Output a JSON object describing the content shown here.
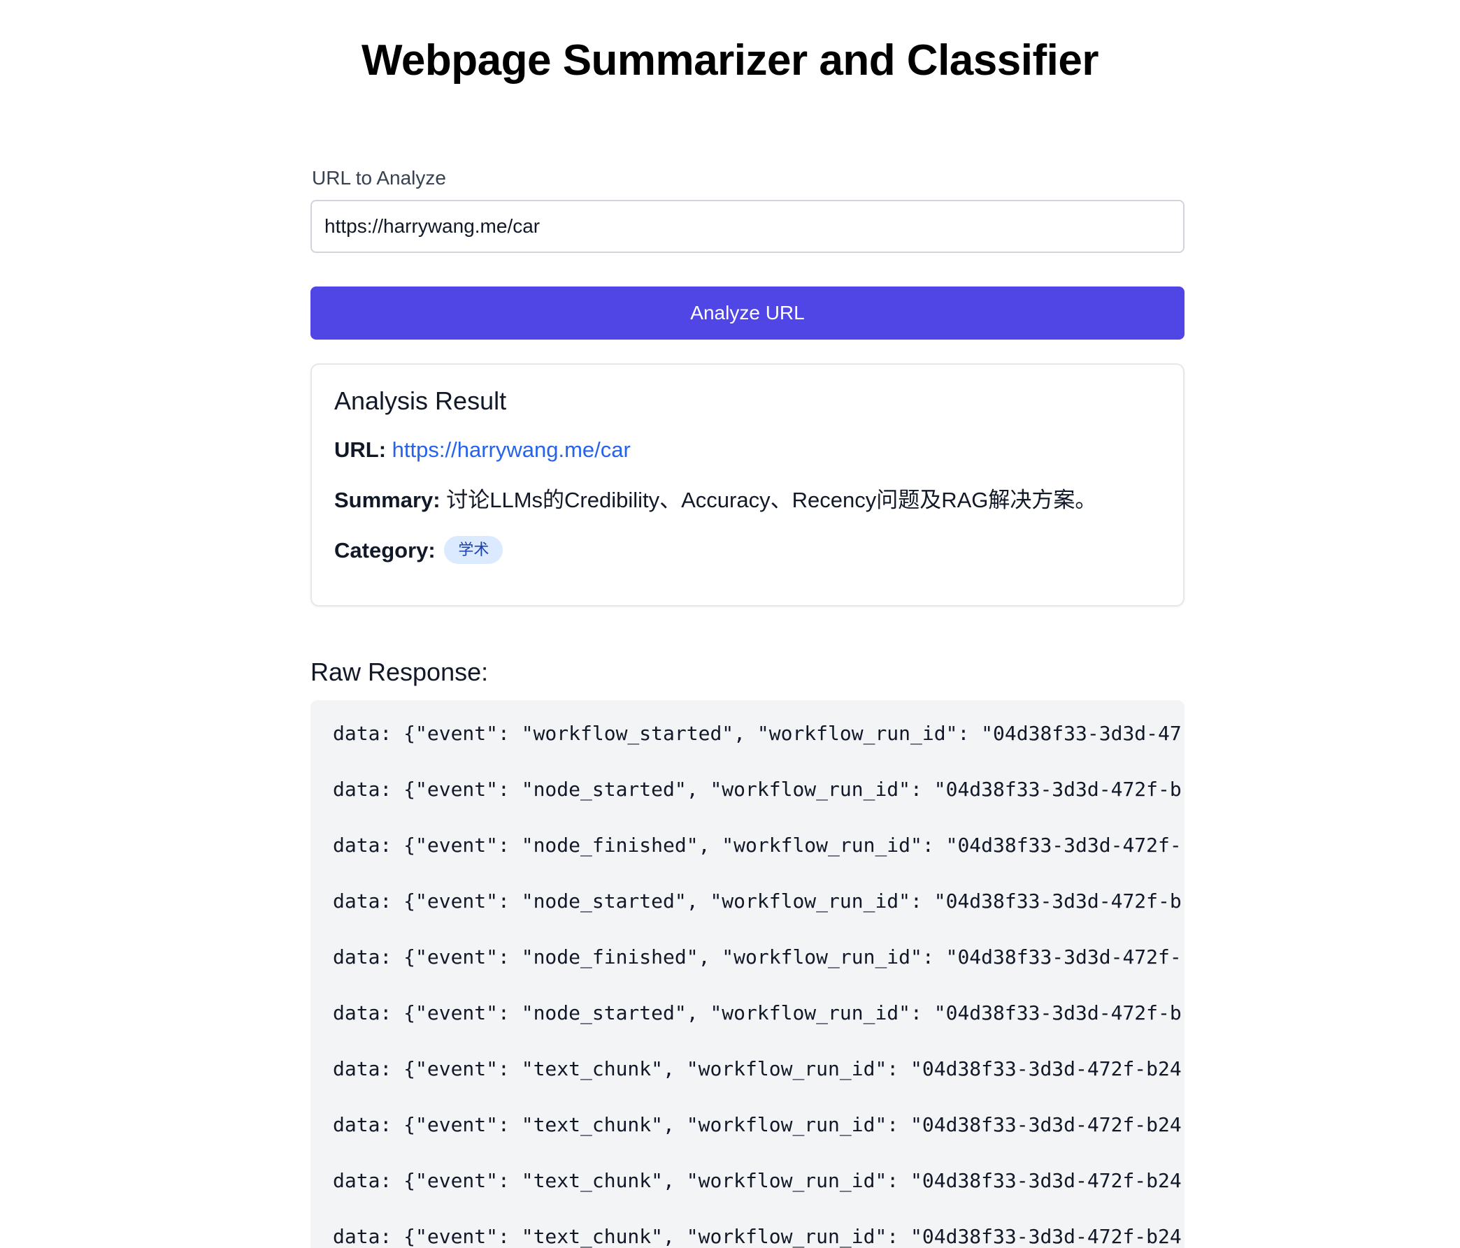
{
  "header": {
    "title": "Webpage Summarizer and Classifier"
  },
  "form": {
    "url_label": "URL to Analyze",
    "url_value": "https://harrywang.me/car",
    "analyze_button_label": "Analyze URL"
  },
  "result": {
    "title": "Analysis Result",
    "url_key": "URL:",
    "url_value": "https://harrywang.me/car",
    "summary_key": "Summary:",
    "summary_value": "讨论LLMs的Credibility、Accuracy、Recency问题及RAG解决方案。",
    "category_key": "Category:",
    "category_value": "学术"
  },
  "raw": {
    "title": "Raw Response:",
    "lines": [
      "data: {\"event\": \"workflow_started\", \"workflow_run_id\": \"04d38f33-3d3d-47",
      "data: {\"event\": \"node_started\", \"workflow_run_id\": \"04d38f33-3d3d-472f-b",
      "data: {\"event\": \"node_finished\", \"workflow_run_id\": \"04d38f33-3d3d-472f-",
      "data: {\"event\": \"node_started\", \"workflow_run_id\": \"04d38f33-3d3d-472f-b",
      "data: {\"event\": \"node_finished\", \"workflow_run_id\": \"04d38f33-3d3d-472f-",
      "data: {\"event\": \"node_started\", \"workflow_run_id\": \"04d38f33-3d3d-472f-b",
      "data: {\"event\": \"text_chunk\", \"workflow_run_id\": \"04d38f33-3d3d-472f-b24",
      "data: {\"event\": \"text_chunk\", \"workflow_run_id\": \"04d38f33-3d3d-472f-b24",
      "data: {\"event\": \"text_chunk\", \"workflow_run_id\": \"04d38f33-3d3d-472f-b24",
      "data: {\"event\": \"text_chunk\", \"workflow_run_id\": \"04d38f33-3d3d-472f-b24"
    ]
  },
  "colors": {
    "accent": "#4f46e5",
    "link": "#2563eb",
    "badge_bg": "#dbeafe",
    "badge_text": "#1e40af",
    "code_bg": "#f3f4f6"
  }
}
